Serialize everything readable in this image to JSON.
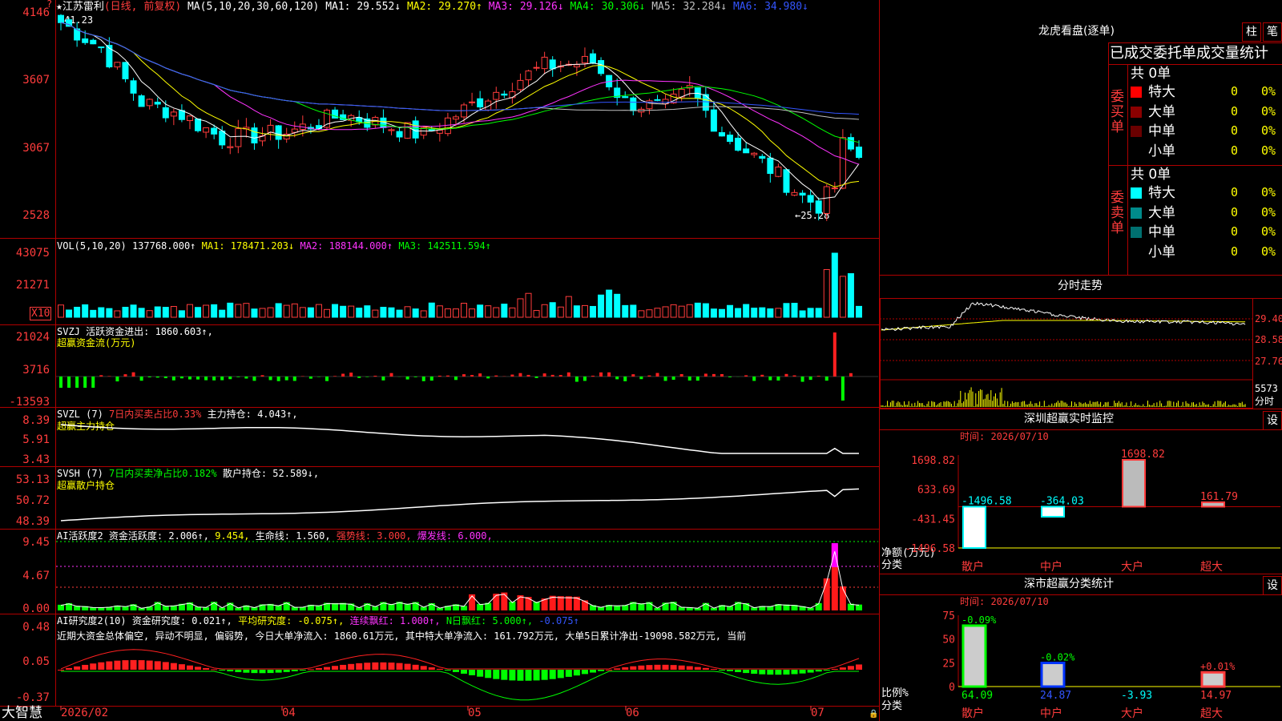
{
  "stock": {
    "title_prefix": "★",
    "name": "江苏雷利",
    "mode": "(日线, 前复权)"
  },
  "ma_line": {
    "label": "MA(5,10,20,30,60,120)",
    "items": [
      {
        "text": "MA1: 29.552↓",
        "color": "#ffffff"
      },
      {
        "text": "MA2: 29.270↑",
        "color": "#ffff00"
      },
      {
        "text": "MA3: 29.126↓",
        "color": "#ff33ff"
      },
      {
        "text": "MA4: 30.306↓",
        "color": "#00ff00"
      },
      {
        "text": "MA5: 32.284↓",
        "color": "#c0c0c0"
      },
      {
        "text": "MA6: 34.980↓",
        "color": "#3355ff"
      }
    ]
  },
  "price_axis": [
    "4146",
    "3607",
    "3067",
    "2528"
  ],
  "price_high_mark": "41.23",
  "price_low_mark": "←25.28",
  "vol_panel": {
    "label": "VOL(5,10,20)",
    "value": "137768.000↑",
    "ma1": "MA1: 178471.203↓",
    "ma2": "MA2: 188144.000↑",
    "ma3": "MA3: 142511.594↑",
    "axis": [
      "43075",
      "21271"
    ],
    "unit": "X10"
  },
  "svzj_panel": {
    "label": "SVZJ  活跃资金进出: 1860.603↑,",
    "sub": "超赢资金流(万元)",
    "axis": [
      "21024",
      "3716",
      "-13593"
    ]
  },
  "svzl_panel": {
    "label": "SVZL (7)",
    "ratio": "7日内买卖占比0.33%",
    "hold": "主力持仓: 4.043↑,",
    "sub": "超赢主力持仓",
    "axis": [
      "8.39",
      "5.91",
      "3.43"
    ]
  },
  "svsh_panel": {
    "label": "SVSH (7)",
    "ratio": "7日内买卖净占比0.182%",
    "hold": "散户持仓: 52.589↓,",
    "sub": "超赢散户持仓",
    "axis": [
      "53.13",
      "50.72",
      "48.39"
    ]
  },
  "ai_active": {
    "label": "AI活跃度2",
    "v1": "资金活跃度: 2.006↑,",
    "v2": "9.454,",
    "v3": "生命线: 1.560,",
    "v4": "强势线: 3.000,",
    "v5": "爆发线: 6.000,",
    "axis": [
      "9.45",
      "4.67",
      "0.00"
    ]
  },
  "ai_research": {
    "label": "AI研究度2(10)",
    "v1": "资金研究度: 0.021↑,",
    "v2": "平均研究度: -0.075↑,",
    "v3": "连续飘红: 1.000↑,",
    "v4": "N日飘红: 5.000↑,",
    "v5": "-0.075↑",
    "comment": "近期大资金总体偏空, 异动不明显, 偏弱势, 今日大单净流入: 1860.61万元, 其中特大单净流入: 161.792万元, 大单5日累计净出-19098.582万元, 当前",
    "axis": [
      "0.48",
      "0.05",
      "-0.37"
    ]
  },
  "date_axis": [
    "2026/02",
    "04",
    "05",
    "06",
    "07"
  ],
  "brand": "大智慧",
  "dragon": {
    "title": "龙虎看盘(逐单)",
    "btn1": "柱",
    "btn2": "笔",
    "header": "已成交委托单成交量统计",
    "buy_label": "委买单",
    "sell_label": "委卖单",
    "buy_total": "共 0单",
    "sell_total": "共 0单",
    "buy_rows": [
      {
        "name": "特大",
        "count": "0",
        "pct": "0%",
        "color": "#ff0000"
      },
      {
        "name": "大单",
        "count": "0",
        "pct": "0%",
        "color": "#8b0000"
      },
      {
        "name": "中单",
        "count": "0",
        "pct": "0%",
        "color": "#6a0000"
      },
      {
        "name": "小单",
        "count": "0",
        "pct": "0%",
        "color": "#000000"
      }
    ],
    "sell_rows": [
      {
        "name": "特大",
        "count": "0",
        "pct": "0%",
        "color": "#00ffff"
      },
      {
        "name": "大单",
        "count": "0",
        "pct": "0%",
        "color": "#008b8b"
      },
      {
        "name": "中单",
        "count": "0",
        "pct": "0%",
        "color": "#007070"
      },
      {
        "name": "小单",
        "count": "0",
        "pct": "0%",
        "color": "#000000"
      }
    ]
  },
  "intraday": {
    "title": "分时走势",
    "axis": [
      "29.40",
      "28.58",
      "27.76"
    ],
    "vol": "5573",
    "vol_unit": "分时"
  },
  "sz_monitor": {
    "title": "深圳超赢实时监控",
    "btn": "设",
    "time": "时间: 2026/07/10",
    "axis": [
      "1698.82",
      "633.69",
      "-431.45",
      "-1496.58"
    ],
    "ylabel": "净额(万元)",
    "xlabel": "分类",
    "categories": [
      "散户",
      "中户",
      "大户",
      "超大"
    ],
    "values": [
      -1496.58,
      -364.03,
      1698.82,
      161.79
    ],
    "value_labels": [
      "-1496.58",
      "-364.03",
      "1698.82",
      "161.79"
    ]
  },
  "sz_class": {
    "title": "深市超赢分类统计",
    "btn": "设",
    "time": "时间: 2026/07/10",
    "axis": [
      "75",
      "50",
      "25",
      "0"
    ],
    "ylabel": "比例%",
    "xlabel": "分类",
    "categories": [
      "散户",
      "中户",
      "大户",
      "超大"
    ],
    "values": [
      64.09,
      24.87,
      -3.93,
      14.97
    ],
    "value_labels": [
      "64.09",
      "24.87",
      "-3.93",
      "14.97"
    ],
    "change_labels": [
      "-0.09%",
      "-0.02%",
      "",
      "+0.01%"
    ]
  },
  "chart_data": [
    {
      "type": "bar",
      "title": "深圳超赢实时监控",
      "ylabel": "净额(万元)",
      "xlabel": "分类",
      "categories": [
        "散户",
        "中户",
        "大户",
        "超大"
      ],
      "values": [
        -1496.58,
        -364.03,
        1698.82,
        161.79
      ],
      "ylim": [
        -1496.58,
        1698.82
      ]
    },
    {
      "type": "bar",
      "title": "深市超赢分类统计",
      "ylabel": "比例%",
      "xlabel": "分类",
      "categories": [
        "散户",
        "中户",
        "大户",
        "超大"
      ],
      "values": [
        64.09,
        24.87,
        -3.93,
        14.97
      ],
      "ylim": [
        0,
        75
      ]
    }
  ]
}
